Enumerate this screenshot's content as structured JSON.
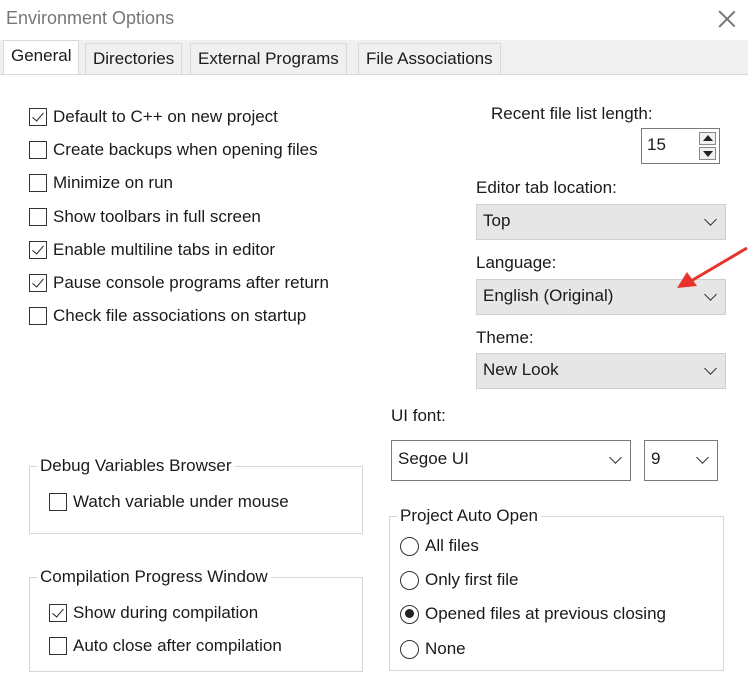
{
  "window": {
    "title": "Environment Options"
  },
  "tabs": [
    {
      "label": "General",
      "active": true
    },
    {
      "label": "Directories",
      "active": false
    },
    {
      "label": "External Programs",
      "active": false
    },
    {
      "label": "File Associations",
      "active": false
    }
  ],
  "options": [
    {
      "label": "Default to C++ on new project",
      "checked": true
    },
    {
      "label": "Create backups when opening files",
      "checked": false
    },
    {
      "label": "Minimize on run",
      "checked": false
    },
    {
      "label": "Show toolbars in full screen",
      "checked": false
    },
    {
      "label": "Enable multiline tabs in editor",
      "checked": true
    },
    {
      "label": "Pause console programs after return",
      "checked": true
    },
    {
      "label": "Check file associations on startup",
      "checked": false
    }
  ],
  "recent": {
    "label": "Recent file list length:",
    "value": "15"
  },
  "editor_tab": {
    "label": "Editor tab location:",
    "value": "Top"
  },
  "language": {
    "label": "Language:",
    "value": "English (Original)"
  },
  "theme": {
    "label": "Theme:",
    "value": "New Look"
  },
  "ui_font": {
    "label": "UI font:",
    "value": "Segoe UI",
    "size": "9"
  },
  "debug_group": {
    "title": "Debug Variables Browser",
    "items": [
      {
        "label": "Watch variable under mouse",
        "checked": false
      }
    ]
  },
  "compile_group": {
    "title": "Compilation Progress Window",
    "items": [
      {
        "label": "Show during compilation",
        "checked": true
      },
      {
        "label": "Auto close after compilation",
        "checked": false
      }
    ]
  },
  "auto_open": {
    "title": "Project Auto Open",
    "options": [
      {
        "label": "All files",
        "selected": false
      },
      {
        "label": "Only first file",
        "selected": false
      },
      {
        "label": "Opened files at previous closing",
        "selected": true
      },
      {
        "label": "None",
        "selected": false
      }
    ]
  },
  "icons": {
    "close": "close-icon",
    "dropdown": "chevron-down-icon",
    "annotation": "red-arrow-icon"
  },
  "colors": {
    "annotation_arrow": "#e8332a",
    "tab_strip": "#f0f0f0",
    "combo_bg": "#e6e6e6"
  }
}
